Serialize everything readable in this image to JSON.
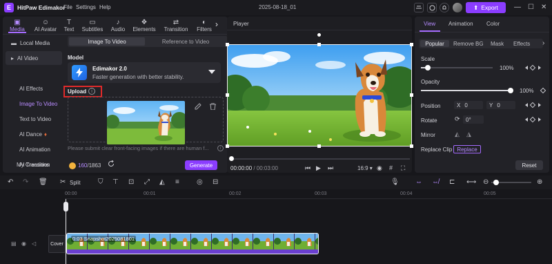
{
  "app": {
    "name": "HitPaw Edimakor",
    "menu": [
      "File",
      "Settings",
      "Help"
    ],
    "document_title": "2025-08-18_01",
    "export_label": "Export"
  },
  "left_panel": {
    "tabs": [
      {
        "label": "Media",
        "icon": "media-icon"
      },
      {
        "label": "AI Avatar",
        "icon": "ai-avatar-icon"
      },
      {
        "label": "Text",
        "icon": "text-icon"
      },
      {
        "label": "Subtitles",
        "icon": "subtitles-icon"
      },
      {
        "label": "Audio",
        "icon": "audio-icon"
      },
      {
        "label": "Elements",
        "icon": "elements-icon"
      },
      {
        "label": "Transition",
        "icon": "transition-icon"
      },
      {
        "label": "Filters",
        "icon": "filters-icon"
      }
    ],
    "sidebar": [
      {
        "label": "Local Media",
        "icon": "folder-icon"
      },
      {
        "label": "AI Video",
        "icon": "ai-video-icon"
      },
      {
        "label": "AI Effects"
      },
      {
        "label": "Image To Video"
      },
      {
        "label": "Text to Video"
      },
      {
        "label": "AI Dance"
      },
      {
        "label": "AI Animation"
      },
      {
        "label": "AI Transition"
      },
      {
        "label": "My Creations"
      }
    ],
    "mode_tabs": [
      "Image To Video",
      "Reference to Video"
    ],
    "model": {
      "section_label": "Model",
      "name": "Edimakor 2.0",
      "description": "Faster generation with better stability."
    },
    "upload": {
      "section_label": "Upload",
      "hint": "Please submit clear front-facing images if there are human f..."
    },
    "credits": {
      "used": "160",
      "total": "/1863"
    },
    "generate_label": "Generate"
  },
  "player": {
    "title": "Player",
    "current_time": "00:00:00",
    "duration": " / 00:03:00",
    "aspect_ratio": "16:9"
  },
  "right_panel": {
    "tabs": [
      "View",
      "Animation",
      "Color"
    ],
    "subtabs": [
      "Popular",
      "Remove BG",
      "Mask",
      "Effects"
    ],
    "scale": {
      "label": "Scale",
      "value": "100%",
      "fraction": 0.1
    },
    "opacity": {
      "label": "Opacity",
      "value": "100%",
      "fraction": 1.0
    },
    "position": {
      "label": "Position",
      "x_label": "X",
      "x": "0",
      "y_label": "Y",
      "y": "0"
    },
    "rotate": {
      "label": "Rotate",
      "value": "0°"
    },
    "mirror": {
      "label": "Mirror"
    },
    "replace_clip": {
      "label": "Replace Clip",
      "button": "Replace"
    },
    "reset_label": "Reset"
  },
  "timeline": {
    "split_label": "Split",
    "ticks": [
      "00:00",
      "00:01",
      "00:02",
      "00:03",
      "00:04",
      "00:05"
    ],
    "cover_label": "Cover",
    "clip_label": "0:03 Snapshot2025081801"
  },
  "colors": {
    "accent": "#8b3dff",
    "accent_text": "#b58bff",
    "highlight_frame": "#e02a2a",
    "background": "#17171b"
  }
}
